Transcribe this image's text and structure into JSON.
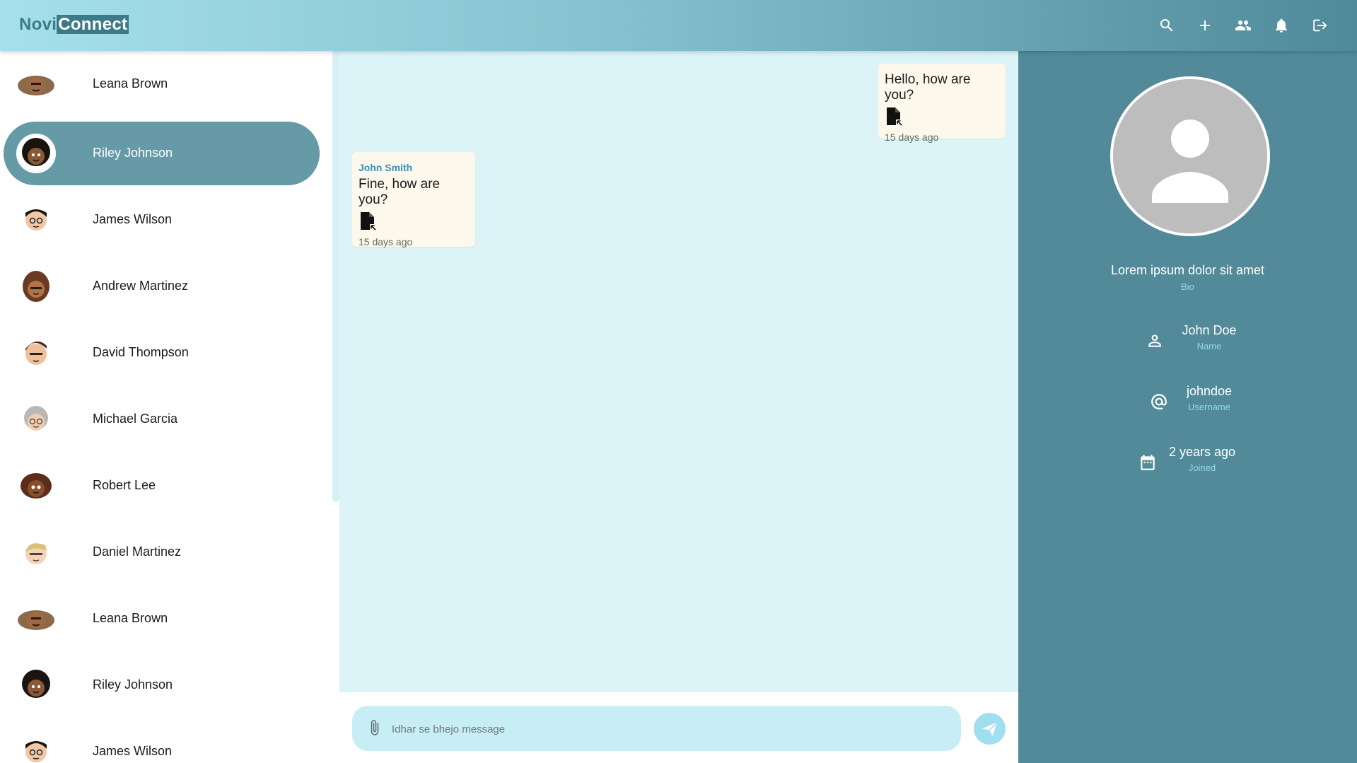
{
  "header": {
    "logo_part1": "Novi",
    "logo_part2": "Connect",
    "icons": [
      "search-icon",
      "add-icon",
      "group-icon",
      "notification-bell-icon",
      "logout-icon"
    ]
  },
  "contacts": [
    {
      "name": "Leana Brown",
      "active": false
    },
    {
      "name": "Riley Johnson",
      "active": true
    },
    {
      "name": "James Wilson",
      "active": false
    },
    {
      "name": "Andrew Martinez",
      "active": false
    },
    {
      "name": "David Thompson",
      "active": false
    },
    {
      "name": "Michael Garcia",
      "active": false
    },
    {
      "name": "Robert Lee",
      "active": false
    },
    {
      "name": "Daniel Martinez",
      "active": false
    },
    {
      "name": "Leana Brown",
      "active": false
    },
    {
      "name": "Riley Johnson",
      "active": false
    },
    {
      "name": "James Wilson",
      "active": false
    }
  ],
  "messages": [
    {
      "text": "Hello, how are you?",
      "time": "15 days ago",
      "outgoing": true
    },
    {
      "sender": "John Smith",
      "text": "Fine, how are you?",
      "time": "15 days ago",
      "outgoing": false
    }
  ],
  "composer": {
    "placeholder": "Idhar se bhejo message"
  },
  "profile": {
    "bio": "Lorem ipsum dolor sit amet",
    "bio_label": "Bio",
    "name": "John Doe",
    "name_label": "Name",
    "username": "johndoe",
    "username_label": "Username",
    "joined": "2 years ago",
    "joined_label": "Joined"
  },
  "colors": {
    "accent": "#669aa7",
    "header_start": "#a5e0ec",
    "header_end": "#4f8a9a",
    "chat_bg": "#dcf4f8",
    "bubble_bg": "#fdf8ec",
    "profile_bg": "#528a9a",
    "label_cyan": "#8fdbef",
    "sender_blue": "#3a90b6"
  }
}
